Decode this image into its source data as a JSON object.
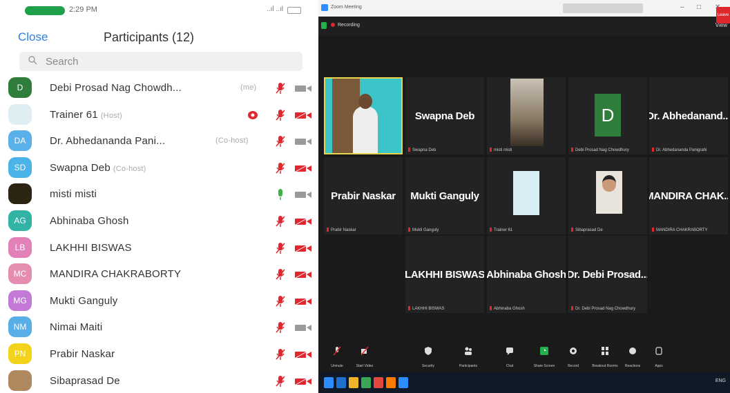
{
  "phone": {
    "status": {
      "time": "2:29 PM",
      "signal": "..ıl ..ıl",
      "battery": ""
    },
    "header": {
      "close_label": "Close",
      "title": "Participants (12)"
    },
    "search": {
      "placeholder": "Search"
    },
    "participants": [
      {
        "initials": "D",
        "name": "Debi Prosad Nag Chowdh...",
        "role": "(me)",
        "avatar_color": "#2e7d3a",
        "mic": "muted",
        "cam": "on",
        "recording": false
      },
      {
        "initials": "",
        "name": "Trainer 61",
        "role": "(Host)",
        "avatar_color": "#dfeef3",
        "mic": "muted",
        "cam": "off",
        "recording": true
      },
      {
        "initials": "DA",
        "name": "Dr. Abhedananda Pani...",
        "role": "(Co-host)",
        "avatar_color": "#5ab1ea",
        "mic": "muted",
        "cam": "on",
        "recording": false
      },
      {
        "initials": "SD",
        "name": "Swapna Deb",
        "role": "(Co-host)",
        "avatar_color": "#4ab3e8",
        "mic": "muted",
        "cam": "off",
        "recording": false
      },
      {
        "initials": "",
        "name": "misti misti",
        "role": "",
        "avatar_color": "#2b2412",
        "mic": "on",
        "cam": "on",
        "recording": false
      },
      {
        "initials": "AG",
        "name": "Abhinaba Ghosh",
        "role": "",
        "avatar_color": "#33b3a6",
        "mic": "muted",
        "cam": "off",
        "recording": false
      },
      {
        "initials": "LB",
        "name": "LAKHHI BISWAS",
        "role": "",
        "avatar_color": "#e281b8",
        "mic": "muted",
        "cam": "off",
        "recording": false
      },
      {
        "initials": "MC",
        "name": "MANDIRA CHAKRABORTY",
        "role": "",
        "avatar_color": "#e58db0",
        "mic": "muted",
        "cam": "off",
        "recording": false
      },
      {
        "initials": "MG",
        "name": "Mukti Ganguly",
        "role": "",
        "avatar_color": "#c27ad6",
        "mic": "muted",
        "cam": "off",
        "recording": false
      },
      {
        "initials": "NM",
        "name": "Nimai Maiti",
        "role": "",
        "avatar_color": "#5aaee8",
        "mic": "muted",
        "cam": "on",
        "recording": false
      },
      {
        "initials": "PN",
        "name": "Prabir Naskar",
        "role": "",
        "avatar_color": "#f3d21c",
        "mic": "muted",
        "cam": "off",
        "recording": false
      },
      {
        "initials": "",
        "name": "Sibaprasad De",
        "role": "",
        "avatar_color": "#b08860",
        "mic": "muted",
        "cam": "off",
        "recording": false
      }
    ]
  },
  "desktop": {
    "window_title": "Zoom Meeting",
    "recording_label": "Recording",
    "view_label": "View",
    "tiles": [
      {
        "display": "",
        "label": "",
        "kind": "video-person",
        "highlight": true
      },
      {
        "display": "Swapna Deb",
        "label": "Swapna Deb",
        "kind": "name"
      },
      {
        "display": "",
        "label": "misti misti",
        "kind": "video-room"
      },
      {
        "display": "D",
        "label": "Debi Prosad Nag Chowdhury",
        "kind": "letter"
      },
      {
        "display": "Dr. Abhedanand...",
        "label": "Dr. Abhedananda Panigrahi",
        "kind": "name"
      },
      {
        "display": "Prabir Naskar",
        "label": "Prabir Naskar",
        "kind": "name"
      },
      {
        "display": "Mukti Ganguly",
        "label": "Mukti Ganguly",
        "kind": "name"
      },
      {
        "display": "",
        "label": "Trainer 61",
        "kind": "blank-light"
      },
      {
        "display": "",
        "label": "Sibaprasad De",
        "kind": "video-face"
      },
      {
        "display": "MANDIRA CHAK...",
        "label": "MANDIRA CHAKRABORTY",
        "kind": "name"
      },
      {
        "display": "LAKHHI BISWAS",
        "label": "LAKHHI BISWAS",
        "kind": "name"
      },
      {
        "display": "Abhinaba Ghosh",
        "label": "Abhinaba Ghosh",
        "kind": "name"
      },
      {
        "display": "Dr. Debi Prosad...",
        "label": "Dr. Debi Prosad Nag Chowdhury",
        "kind": "name"
      }
    ],
    "toolbar": [
      {
        "label": "Unmute",
        "icon": "mic-muted-icon"
      },
      {
        "label": "Start Video",
        "icon": "video-off-icon"
      },
      {
        "label": "Security",
        "icon": "shield-icon"
      },
      {
        "label": "Participants",
        "icon": "participants-icon"
      },
      {
        "label": "Chat",
        "icon": "chat-icon"
      },
      {
        "label": "Share Screen",
        "icon": "share-screen-icon"
      },
      {
        "label": "Record",
        "icon": "record-icon"
      },
      {
        "label": "Breakout Rooms",
        "icon": "breakout-icon"
      },
      {
        "label": "Reactions",
        "icon": "reactions-icon"
      },
      {
        "label": "Apps",
        "icon": "apps-icon"
      }
    ],
    "end_label": "Leave",
    "taskbar_tray": "ENG"
  },
  "colors": {
    "accent_blue": "#2d7fe3",
    "muted_red": "#e0272e",
    "zoom_green": "#23b14d"
  }
}
